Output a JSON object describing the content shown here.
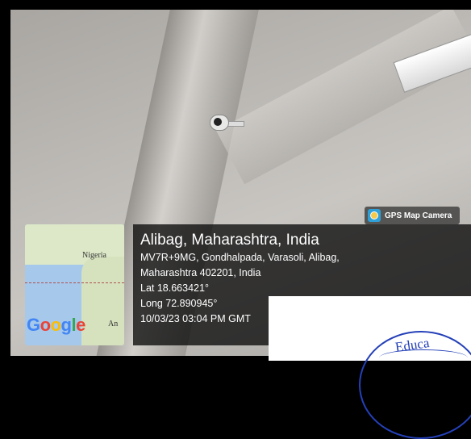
{
  "badge": {
    "icon": "gps-map-camera-icon",
    "label": "GPS Map Camera"
  },
  "map": {
    "country_label": "Nigeria",
    "partial_label": "An",
    "provider_logo": [
      "G",
      "o",
      "o",
      "g",
      "l",
      "e"
    ]
  },
  "location": {
    "place": "Alibag, Maharashtra, India",
    "address_line1": "MV7R+9MG, Gondhalpada, Varasoli, Alibag,",
    "address_line2": "Maharashtra 402201, India",
    "lat": "Lat 18.663421°",
    "long": "Long 72.890945°",
    "datetime": "10/03/23 03:04 PM GMT"
  },
  "stamp": {
    "text": "Educa"
  },
  "colors": {
    "info_bg": "#0f0f0f",
    "stamp_blue": "#2440b8",
    "badge_icon": "#2f9fd8"
  }
}
